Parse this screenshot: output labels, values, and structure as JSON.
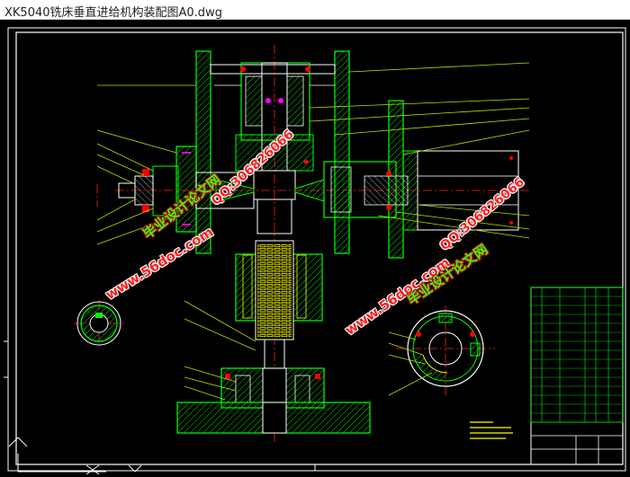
{
  "window": {
    "title": "XK5040铣床垂直进给机构装配图A0.dwg"
  },
  "watermarks": {
    "site": "www.56doc.com",
    "brand": "毕业设计论文网",
    "qq": "QQ:306826066"
  },
  "colors": {
    "background": "#000000",
    "outline": "#ffffff",
    "part": "#00ff00",
    "leader": "#b8e000",
    "centerline": "#ff2020",
    "hatch": "#00dd00",
    "ring": "#ff00ff",
    "accent": "#ffff00"
  },
  "icons": {
    "ucs": "ucs-axis-icon"
  }
}
